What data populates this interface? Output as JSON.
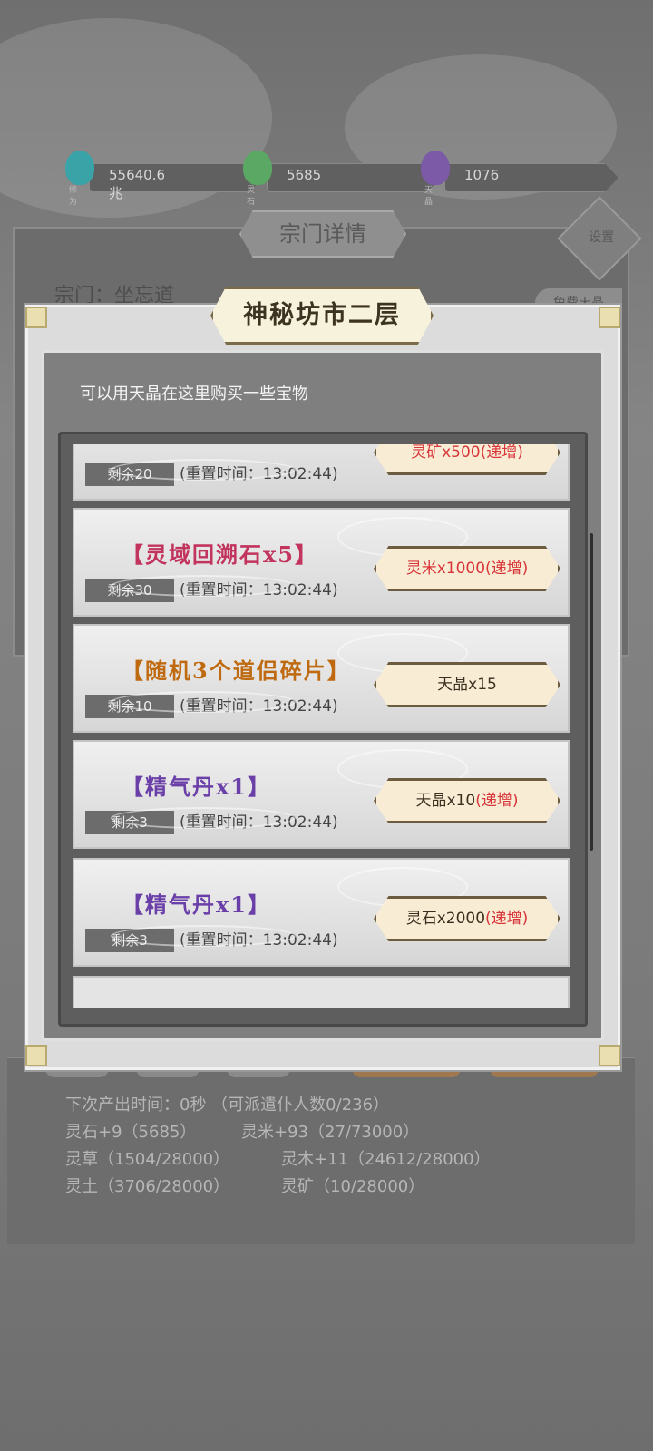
{
  "currency": [
    {
      "caption": "修为",
      "value": "55640.6兆",
      "color": "#3aa3a8"
    },
    {
      "caption": "灵石",
      "value": "5685",
      "color": "#5aa864"
    },
    {
      "caption": "天晶",
      "value": "1076",
      "color": "#7c5aa8"
    }
  ],
  "background": {
    "sect_title": "宗门详情",
    "settings_label": "设置",
    "sect_name": "宗门：坐忘道",
    "free_button": "免费天晶"
  },
  "modal": {
    "title": "神秘坊市二层",
    "description": "可以用天晶在这里购买一些宝物"
  },
  "shop_items": [
    {
      "name": "",
      "remaining": "剩余20",
      "reset": "(重置时间：13:02:44)",
      "price_base": "灵矿x500",
      "price_increment": "(递增)",
      "base_red": true
    },
    {
      "name": "【灵域回溯石x5】",
      "remaining": "剩余30",
      "reset": "(重置时间：13:02:44)",
      "price_base": "灵米x1000",
      "price_increment": "(递增)",
      "name_color": "pink",
      "base_red": true
    },
    {
      "name": "【随机3个道侣碎片】",
      "remaining": "剩余10",
      "reset": "(重置时间：13:02:44)",
      "price_base": "天晶x15",
      "price_increment": "",
      "name_color": "orange",
      "base_red": false
    },
    {
      "name": "【精气丹x1】",
      "remaining": "剩余3",
      "reset": "(重置时间：13:02:44)",
      "price_base": "天晶x10",
      "price_increment": "(递增)",
      "name_color": "purple",
      "base_red": false
    },
    {
      "name": "【精气丹x1】",
      "remaining": "剩余3",
      "reset": "(重置时间：13:02:44)",
      "price_base": "灵石x2000",
      "price_increment": "(递增)",
      "name_color": "purple",
      "base_red": false
    }
  ],
  "stats": {
    "line1": "下次产出时间：0秒 （可派遣仆人数0/236）",
    "line2a": "灵石+9（5685）",
    "line2b": "灵米+93（27/73000）",
    "line3a": "灵草（1504/28000）",
    "line3b": "灵木+11（24612/28000）",
    "line4a": "灵土（3706/28000）",
    "line4b": "灵矿（10/28000）"
  }
}
